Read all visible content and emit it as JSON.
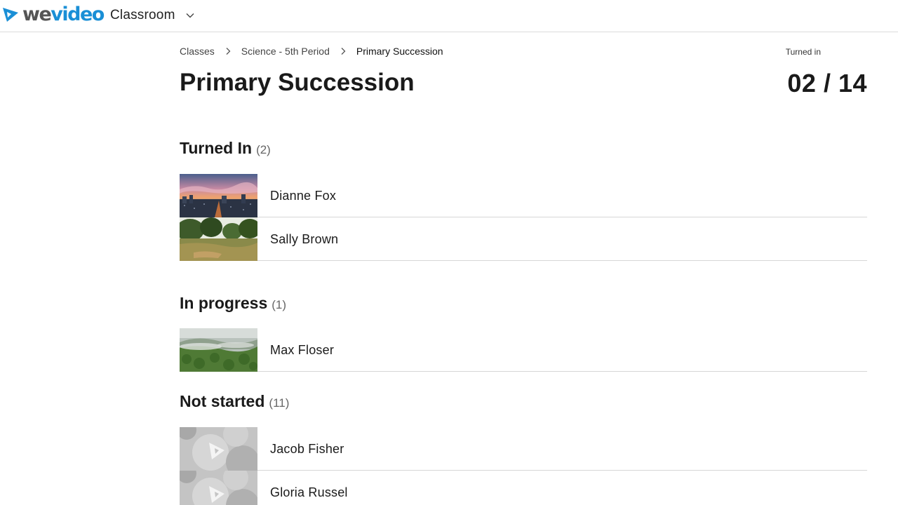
{
  "header": {
    "app_name": "Classroom",
    "brand_color": "#1a8fd6"
  },
  "breadcrumb": {
    "items": [
      "Classes",
      "Science - 5th Period",
      "Primary Succession"
    ]
  },
  "page": {
    "title": "Primary Succession",
    "turned_in_label": "Turned in",
    "turned_in_count": "02 / 14"
  },
  "sections": {
    "turned_in": {
      "name": "Turned In",
      "count": "(2)",
      "students": [
        "Dianne Fox",
        "Sally Brown"
      ]
    },
    "in_progress": {
      "name": "In progress",
      "count": "(1)",
      "students": [
        "Max Floser"
      ]
    },
    "not_started": {
      "name": "Not started",
      "count": "(11)",
      "students": [
        "Jacob Fisher",
        "Gloria Russel"
      ]
    }
  }
}
